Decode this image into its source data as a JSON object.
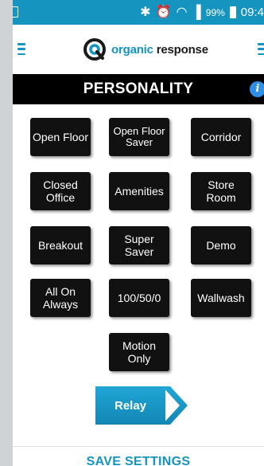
{
  "status_bar": {
    "icons": [
      "bluetooth-icon",
      "alarm-icon",
      "wifi-icon",
      "signal-icon"
    ],
    "battery_percent": "99%",
    "time": "09:4"
  },
  "header": {
    "logo_word_1": "organic",
    "logo_word_2": "response"
  },
  "page": {
    "title": "PERSONALITY",
    "info_glyph": "i"
  },
  "personalities": [
    "Open Floor",
    "Open Floor Saver",
    "Corridor",
    "Closed Office",
    "Amenities",
    "Store Room",
    "Breakout",
    "Super Saver",
    "Demo",
    "All On Always",
    "100/50/0",
    "Wallwash",
    "Motion Only"
  ],
  "relay_label": "Relay",
  "footer": {
    "save_label": "SAVE SETTINGS"
  },
  "colors": {
    "accent": "#1594bf",
    "tile": "#111111",
    "info": "#2f8fe5"
  }
}
